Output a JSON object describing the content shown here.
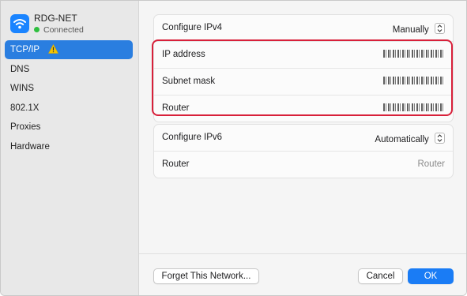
{
  "network": {
    "name": "RDG-NET",
    "status": "Connected"
  },
  "sidebar": {
    "items": [
      {
        "label": "TCP/IP",
        "active": true,
        "warning": true
      },
      {
        "label": "DNS"
      },
      {
        "label": "WINS"
      },
      {
        "label": "802.1X"
      },
      {
        "label": "Proxies"
      },
      {
        "label": "Hardware"
      }
    ]
  },
  "ipv4": {
    "configure_label": "Configure IPv4",
    "configure_value": "Manually",
    "ip_label": "IP address",
    "subnet_label": "Subnet mask",
    "router_label": "Router"
  },
  "ipv6": {
    "configure_label": "Configure IPv6",
    "configure_value": "Automatically",
    "router_label": "Router",
    "router_placeholder": "Router"
  },
  "footer": {
    "forget_label": "Forget This Network...",
    "cancel_label": "Cancel",
    "ok_label": "OK"
  },
  "colors": {
    "accent": "#1a7cf5",
    "highlight": "#d8203a",
    "connected": "#2fbf3f",
    "warning": "#f5c400"
  },
  "icons": {
    "network": "wifi-icon",
    "warning": "warning-icon",
    "popup": "chevron-updown-icon"
  }
}
